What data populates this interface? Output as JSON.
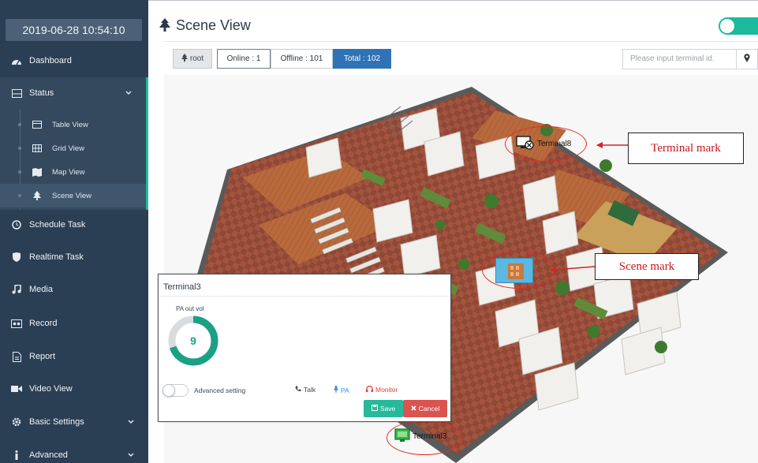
{
  "sidebar": {
    "clock": "2019-06-28 10:54:10",
    "items": [
      {
        "label": "Dashboard",
        "icon": "dashboard-icon"
      },
      {
        "label": "Status",
        "icon": "status-icon"
      },
      {
        "label": "Schedule Task",
        "icon": "clock-icon"
      },
      {
        "label": "Realtime Task",
        "icon": "shield-icon"
      },
      {
        "label": "Media",
        "icon": "music-icon"
      },
      {
        "label": "Record",
        "icon": "record-icon"
      },
      {
        "label": "Report",
        "icon": "report-icon"
      },
      {
        "label": "Video View",
        "icon": "video-icon"
      },
      {
        "label": "Basic Settings",
        "icon": "gear-icon"
      },
      {
        "label": "Advanced",
        "icon": "info-icon"
      }
    ],
    "status_sub": [
      {
        "label": "Table View",
        "icon": "table-icon"
      },
      {
        "label": "Grid View",
        "icon": "grid-icon"
      },
      {
        "label": "Map View",
        "icon": "map-icon"
      },
      {
        "label": "Scene View",
        "icon": "tree-icon"
      }
    ]
  },
  "header": {
    "title": "Scene View"
  },
  "toolbar": {
    "root_label": "root",
    "online": "Online : 1",
    "offline": "Offline : 101",
    "total": "Total : 102",
    "search_placeholder": "Please input terminal id."
  },
  "scene": {
    "terminal_top": "Terminal8",
    "terminal_bottom": "Terminal3",
    "annotations": {
      "terminal_mark": "Terminal mark",
      "scene_mark": "Scene mark"
    }
  },
  "popup": {
    "title": "Terminal3",
    "vol_label": "PA out vol",
    "vol_value": "9",
    "vol_fraction": 0.7,
    "advanced_label": "Advanced setting",
    "talk": "Talk",
    "pa": "PA",
    "monitor": "Monitor",
    "save": "Save",
    "cancel": "Cancel"
  },
  "colors": {
    "sidebar_bg": "#2a3f54",
    "accent_green": "#1abb9c",
    "total_blue": "#2f73b6",
    "annotation_red": "#c8161d"
  }
}
